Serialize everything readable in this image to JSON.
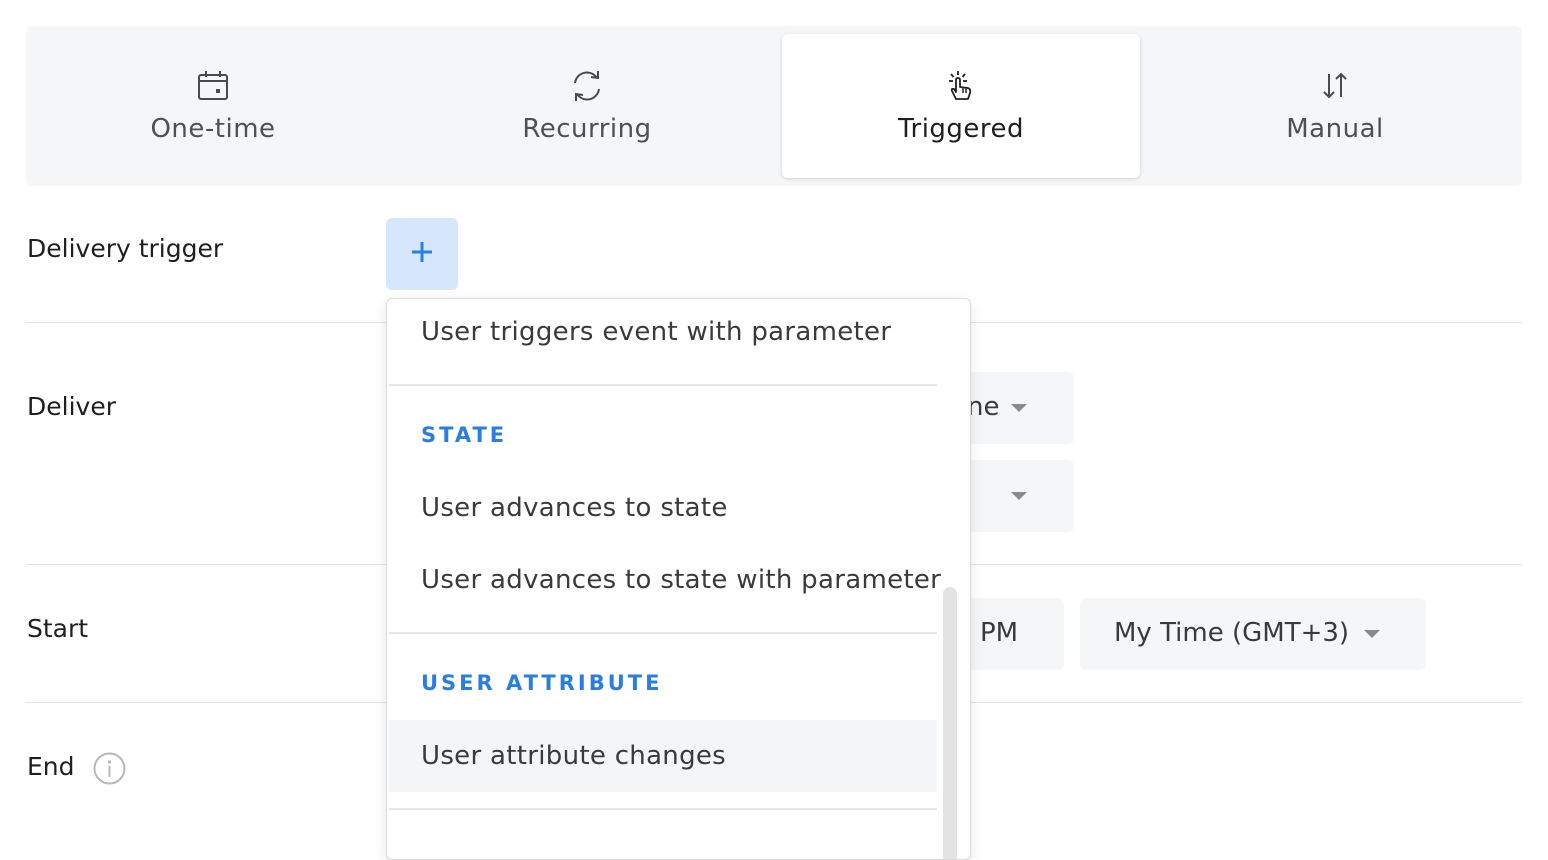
{
  "tabs": [
    {
      "label": "One-time",
      "icon": "calendar-icon"
    },
    {
      "label": "Recurring",
      "icon": "refresh-icon"
    },
    {
      "label": "Triggered",
      "icon": "tap-hand-icon",
      "active": true
    },
    {
      "label": "Manual",
      "icon": "swap-vertical-icon"
    }
  ],
  "form": {
    "delivery_trigger_label": "Delivery trigger",
    "add_trigger_icon": "plus-icon",
    "deliver_label": "Deliver",
    "deliver_select_1_partial": "ne",
    "start_label": "Start",
    "start_time_partial": "PM",
    "timezone_value": "My Time (GMT+3)",
    "end_label": "End",
    "end_info_icon": "info-icon"
  },
  "dropdown": {
    "items_top": [
      "User triggers event with parameter"
    ],
    "sections": [
      {
        "header": "STATE",
        "items": [
          "User advances to state",
          "User advances to state with parameter"
        ]
      },
      {
        "header": "USER ATTRIBUTE",
        "items": [
          "User attribute changes"
        ]
      }
    ]
  },
  "colors": {
    "accent": "#2a7de1",
    "add_button_bg": "#d6e6fb",
    "panel_bg": "#f5f6f8"
  }
}
